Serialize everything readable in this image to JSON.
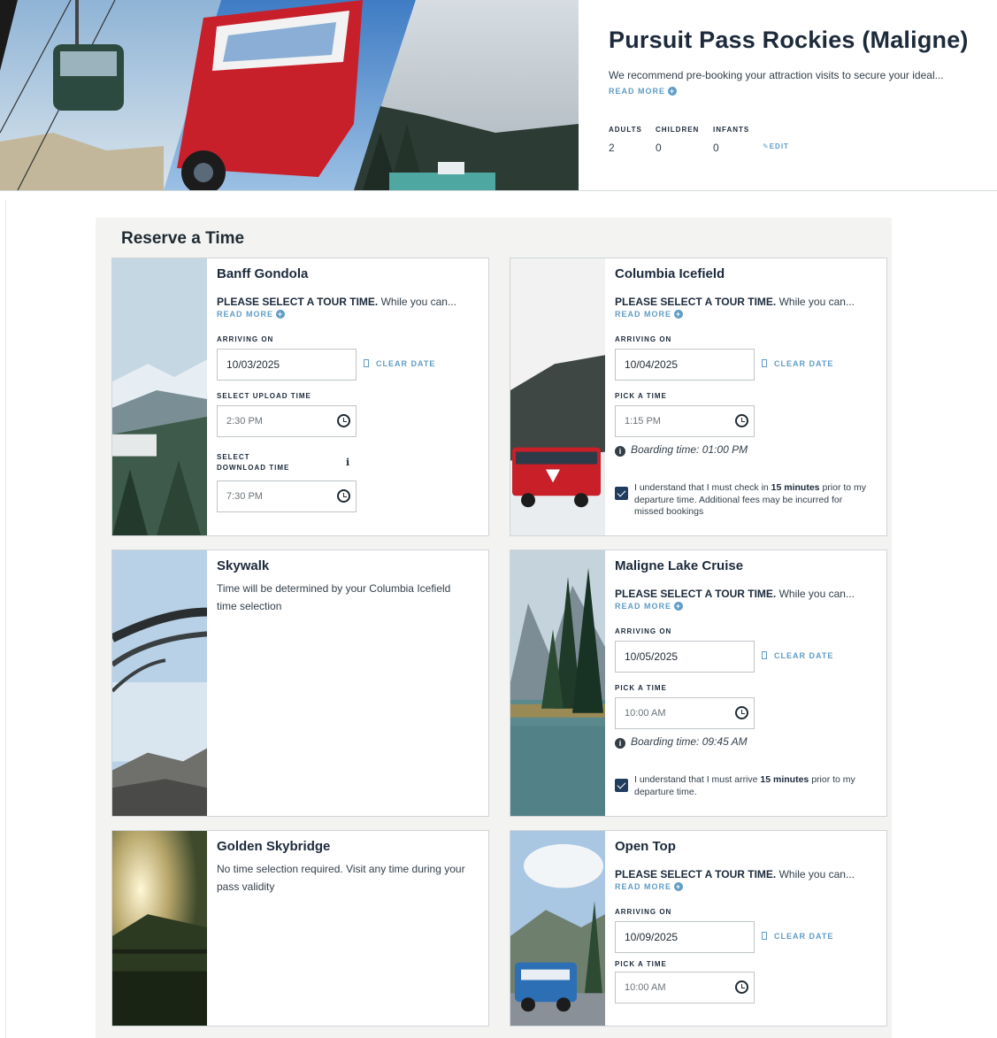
{
  "header": {
    "title": "Pursuit Pass Rockies (Maligne)",
    "description": "We recommend pre-booking your attraction visits to secure your ideal...",
    "read_more": "READ MORE",
    "guests": [
      {
        "label": "ADULTS",
        "value": "2"
      },
      {
        "label": "CHILDREN",
        "value": "0"
      },
      {
        "label": "INFANTS",
        "value": "0"
      }
    ],
    "edit_label": "EDIT"
  },
  "main": {
    "title": "Reserve a Time",
    "cards": [
      {
        "title": "Banff Gondola",
        "instruction_bold": "PLEASE SELECT A TOUR TIME.",
        "instruction_rest": "While you can...",
        "read_more": "READ MORE",
        "arriving_label": "ARRIVING ON",
        "date": "10/03/2025",
        "clear_date": "CLEAR DATE",
        "upload_label": "SELECT UPLOAD TIME",
        "upload_time": "2:30 PM",
        "download_label_1": "SELECT",
        "download_label_2": "DOWNLOAD TIME",
        "download_time": "7:30 PM",
        "info_glyph": "i"
      },
      {
        "title": "Columbia Icefield",
        "instruction_bold": "PLEASE SELECT A TOUR TIME.",
        "instruction_rest": "While you can...",
        "read_more": "READ MORE",
        "arriving_label": "ARRIVING ON",
        "date": "10/04/2025",
        "clear_date": "CLEAR DATE",
        "time_label": "PICK A TIME",
        "time": "1:15 PM",
        "boarding": "Boarding time: 01:00 PM",
        "check_pre": "I understand that I must check in",
        "check_bold": "15 minutes",
        "check_post": "prior to my departure time. Additional fees may be incurred for missed bookings",
        "checked": true
      },
      {
        "title": "Skywalk",
        "text": "Time will be determined by your Columbia Icefield time selection"
      },
      {
        "title": "Maligne Lake Cruise",
        "instruction_bold": "PLEASE SELECT A TOUR TIME.",
        "instruction_rest": "While you can...",
        "read_more": "READ MORE",
        "arriving_label": "ARRIVING ON",
        "date": "10/05/2025",
        "clear_date": "CLEAR DATE",
        "time_label": "PICK A TIME",
        "time": "10:00 AM",
        "boarding": "Boarding time: 09:45 AM",
        "check_pre": "I understand that I must arrive",
        "check_bold": "15 minutes",
        "check_post": "prior to my departure time.",
        "checked": true
      },
      {
        "title": "Golden Skybridge",
        "text": "No time selection required. Visit any time during your pass validity"
      },
      {
        "title": "Open Top",
        "instruction_bold": "PLEASE SELECT A TOUR TIME.",
        "instruction_rest": "While you can...",
        "read_more": "READ MORE",
        "arriving_label": "ARRIVING ON",
        "date": "10/09/2025",
        "clear_date": "CLEAR DATE",
        "time_label": "PICK A TIME",
        "time": "10:00 AM"
      }
    ]
  },
  "colors": {
    "link": "#5f9cc6",
    "heading": "#1c2a3b",
    "checkbox": "#203c5e",
    "panel_bg": "#f3f4f2"
  }
}
